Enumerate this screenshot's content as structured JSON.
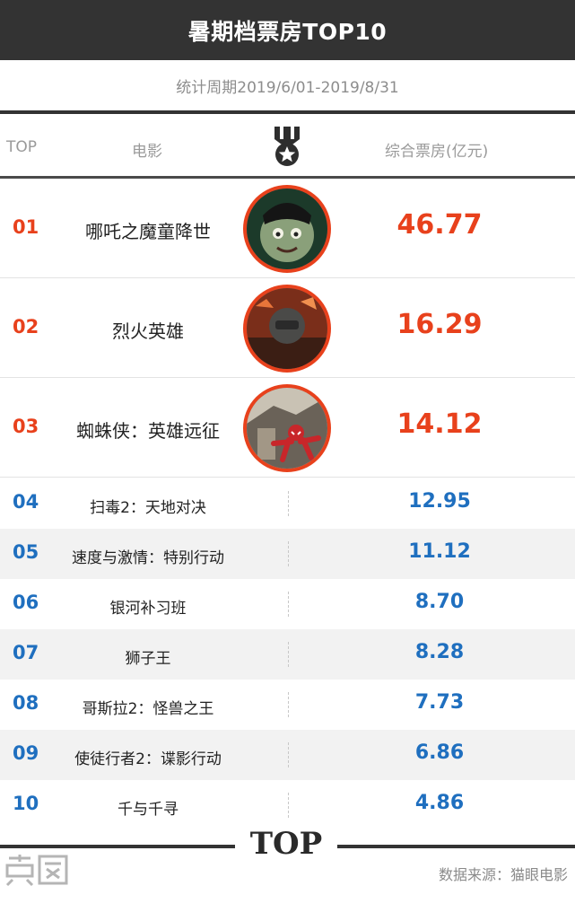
{
  "header": {
    "title": "暑期档票房TOP10"
  },
  "period": "统计周期2019/6/01-2019/8/31",
  "columns": {
    "rank": "TOP",
    "film": "电影",
    "box": "综合票房(亿元)"
  },
  "icons": {
    "column_icon": "medal-star-icon",
    "logo": "logo-icon",
    "footer_mark": "TOP"
  },
  "colors": {
    "header_bg": "#333333",
    "top3_accent": "#e8411c",
    "rest_accent": "#1f6fbf",
    "alt_row_bg": "#f2f2f2"
  },
  "chart_data": {
    "type": "table",
    "title": "暑期档票房TOP10",
    "subtitle": "统计周期2019/6/01-2019/8/31",
    "columns": [
      "TOP",
      "电影",
      "综合票房(亿元)"
    ],
    "rows": [
      {
        "rank": "01",
        "film": "哪吒之魔童降世",
        "box": "46.77"
      },
      {
        "rank": "02",
        "film": "烈火英雄",
        "box": "16.29"
      },
      {
        "rank": "03",
        "film": "蜘蛛侠：英雄远征",
        "box": "14.12"
      },
      {
        "rank": "04",
        "film": "扫毒2：天地对决",
        "box": "12.95"
      },
      {
        "rank": "05",
        "film": "速度与激情：特别行动",
        "box": "11.12"
      },
      {
        "rank": "06",
        "film": "银河补习班",
        "box": "8.70"
      },
      {
        "rank": "07",
        "film": "狮子王",
        "box": "8.28"
      },
      {
        "rank": "08",
        "film": "哥斯拉2：怪兽之王",
        "box": "7.73"
      },
      {
        "rank": "09",
        "film": "使徒行者2：谍影行动",
        "box": "6.86"
      },
      {
        "rank": "10",
        "film": "千与千寻",
        "box": "4.86"
      }
    ]
  },
  "footer": {
    "mark": "TOP",
    "source": "数据来源：猫眼电影"
  }
}
